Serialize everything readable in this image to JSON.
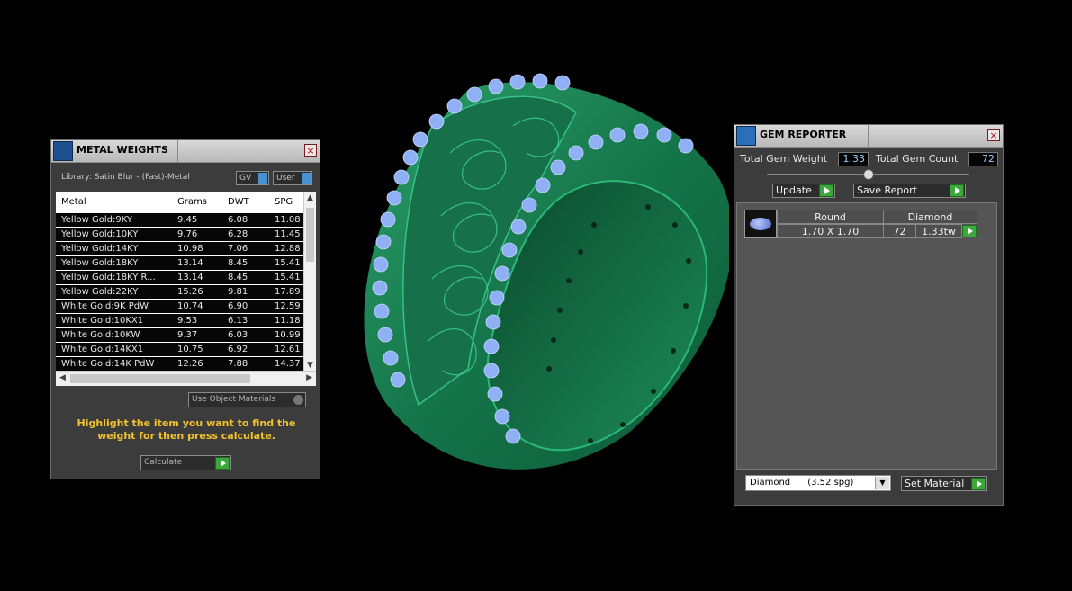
{
  "metal_panel": {
    "title": "METAL WEIGHTS",
    "close_glyph": "×",
    "library_label": "Library: Satin Blur - (Fast)-Metal",
    "toggle_gv": "GV",
    "toggle_user": "User",
    "columns": [
      "Metal",
      "Grams",
      "DWT",
      "SPG"
    ],
    "rows": [
      [
        "Yellow Gold:9KY",
        "9.45",
        "6.08",
        "11.08"
      ],
      [
        "Yellow Gold:10KY",
        "9.76",
        "6.28",
        "11.45"
      ],
      [
        "Yellow Gold:14KY",
        "10.98",
        "7.06",
        "12.88"
      ],
      [
        "Yellow Gold:18KY",
        "13.14",
        "8.45",
        "15.41"
      ],
      [
        "Yellow Gold:18KY R...",
        "13.14",
        "8.45",
        "15.41"
      ],
      [
        "Yellow Gold:22KY",
        "15.26",
        "9.81",
        "17.89"
      ],
      [
        "White Gold:9K PdW",
        "10.74",
        "6.90",
        "12.59"
      ],
      [
        "White Gold:10KX1",
        "9.53",
        "6.13",
        "11.18"
      ],
      [
        "White Gold:10KW",
        "9.37",
        "6.03",
        "10.99"
      ],
      [
        "White Gold:14KX1",
        "10.75",
        "6.92",
        "12.61"
      ],
      [
        "White Gold:14K PdW",
        "12.26",
        "7.88",
        "14.37"
      ]
    ],
    "use_object_materials": "Use Object Materials",
    "hint": "Highlight the item you want to find the weight for then press calculate.",
    "calculate_label": "Calculate"
  },
  "gem_panel": {
    "title": "GEM REPORTER",
    "close_glyph": "×",
    "total_weight_label": "Total Gem Weight",
    "total_weight_value": "1.33",
    "total_count_label": "Total Gem Count",
    "total_count_value": "72",
    "update_label": "Update",
    "save_report_label": "Save Report",
    "gem_row": {
      "shape": "Round",
      "size": "1.70 X 1.70",
      "material": "Diamond",
      "count": "72",
      "weight": "1.33tw"
    },
    "material_select": "Diamond      (3.52 spg)",
    "set_material_label": "Set Material"
  },
  "colors": {
    "metal": "#1f8a5c",
    "gems": "#8fb0f5",
    "hint_text": "#f2c230",
    "panel_bg": "#3c3c3c",
    "green_button": "#3ca83c"
  }
}
